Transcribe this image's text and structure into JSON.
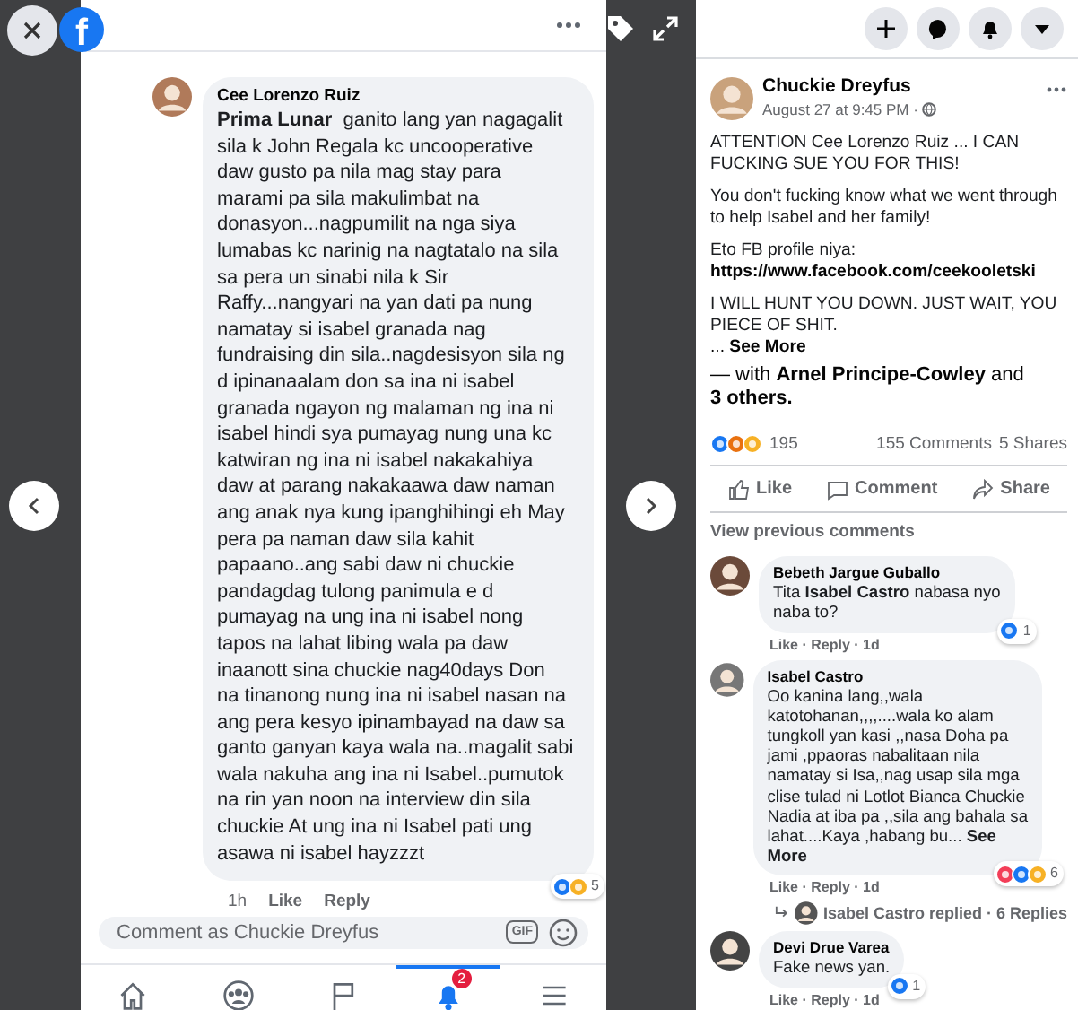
{
  "viewer": {
    "logo": "f"
  },
  "phone": {
    "comment": {
      "author": "Cee Lorenzo Ruiz",
      "text": "**Prima Lunar**  ganito lang yan nagagalit\nsila k John Regala kc uncooperative\ndaw gusto pa nila mag stay para\nmarami pa sila makulimbat na\ndonasyon...nagpumilit na nga siya\nlumabas kc narinig na nagtatalo na sila\nsa pera un sinabi nila k Sir\nRaffy...nangyari na yan dati pa nung\nnamatay si isabel granada nag\nfundraising din sila..nagdesisyon sila ng\nd ipinanaalam don sa ina ni isabel\ngranada ngayon ng malaman ng ina ni\nisabel hindi sya pumayag nung una kc\nkatwiran ng ina ni isabel nakakahiya\ndaw at parang nakakaawa daw naman\nang anak nya kung ipanghihingi eh May\npera pa naman daw sila kahit\npapaano..ang sabi daw ni chuckie\npandagdag tulong panimula e d\npumayag na ung ina ni isabel nong\ntapos na lahat libing wala pa daw\ninaanott sina chuckie nag40days Don\nna tinanong nung ina ni isabel nasan na\nang pera kesyo ipinambayad na daw sa\nganto ganyan kaya wala na..magalit sabi\nwala nakuha ang ina ni Isabel..pumutok\nna rin yan noon na interview din sila\nchuckie At ung ina ni Isabel pati ung\nasawa ni isabel hayzzzt",
      "time": "1h",
      "actions": [
        "Like",
        "Reply"
      ],
      "reactions": [
        {
          "kind": "like"
        },
        {
          "kind": "wow"
        }
      ],
      "reaction_count": "5"
    },
    "composer": {
      "placeholder": "Comment as Chuckie Dreyfus",
      "gif": "GIF"
    },
    "nav": [
      {
        "kind": "home",
        "selected": false
      },
      {
        "kind": "groups",
        "selected": false
      },
      {
        "kind": "flag",
        "selected": false
      },
      {
        "kind": "bell",
        "selected": true,
        "badge": "2"
      },
      {
        "kind": "menu",
        "selected": false
      }
    ]
  },
  "post": {
    "author": "Chuckie Dreyfus",
    "time": "August 27 at 9:45 PM ·",
    "blocks": [
      {
        "kind": "text",
        "text": "ATTENTION Cee Lorenzo Ruiz ... I CAN\nFUCKING SUE YOU FOR THIS!"
      },
      {
        "kind": "text",
        "text": "You don't fucking know what we went through\nto help Isabel and her family!"
      },
      {
        "kind": "label",
        "text": "Eto FB profile niya:"
      },
      {
        "kind": "link",
        "text": "https://www.facebook.com/ceekooletski"
      },
      {
        "kind": "text",
        "text": "I WILL HUNT YOU DOWN. JUST WAIT, YOU\nPIECE OF SHIT."
      }
    ],
    "see_more": {
      "prefix": "...",
      "label": "See More"
    },
    "tagged": "— with **Arnel Principe-Cowley** and\n**3 others.**",
    "reactions": [
      {
        "kind": "like"
      },
      {
        "kind": "angry"
      },
      {
        "kind": "sad"
      }
    ],
    "reaction_count": "195",
    "comments_count": "155 Comments",
    "shares_count": "5 Shares",
    "actions": [
      {
        "kind": "like",
        "label": "Like"
      },
      {
        "kind": "comment",
        "label": "Comment"
      },
      {
        "kind": "share",
        "label": "Share"
      }
    ]
  },
  "view_previous": "View previous comments",
  "comments": [
    {
      "author": "Bebeth Jargue Guballo",
      "text": "Tita **Isabel Castro** nabasa nyo\nnaba to?",
      "meta": "Like · Reply · 1d",
      "reactions": [
        {
          "kind": "like"
        }
      ],
      "reaction_count": "1"
    },
    {
      "author": "Isabel Castro",
      "text": "Oo kanina lang,,wala\nkatotohanan,,,,....wala ko alam\ntungkoll yan kasi ,,nasa Doha pa\njami ,ppaoras nabalitaan nila\nnamatay si Isa,,nag usap sila mga\nclise tulad ni Lotlot Bianca Chuckie\nNadia at iba pa ,,sila ang bahala sa\nlahat....Kaya ,habang bu... **See**\n**More**",
      "meta": "Like · Reply · 1d",
      "reactions": [
        {
          "kind": "love"
        },
        {
          "kind": "like"
        },
        {
          "kind": "haha"
        }
      ],
      "reaction_count": "6",
      "replies": "Isabel Castro replied · 6 Replies"
    },
    {
      "author": "Devi Drue Varea",
      "text": "Fake news yan.",
      "meta": "Like · Reply · 1d",
      "reactions": [
        {
          "kind": "like"
        }
      ],
      "reaction_count": "1"
    }
  ]
}
